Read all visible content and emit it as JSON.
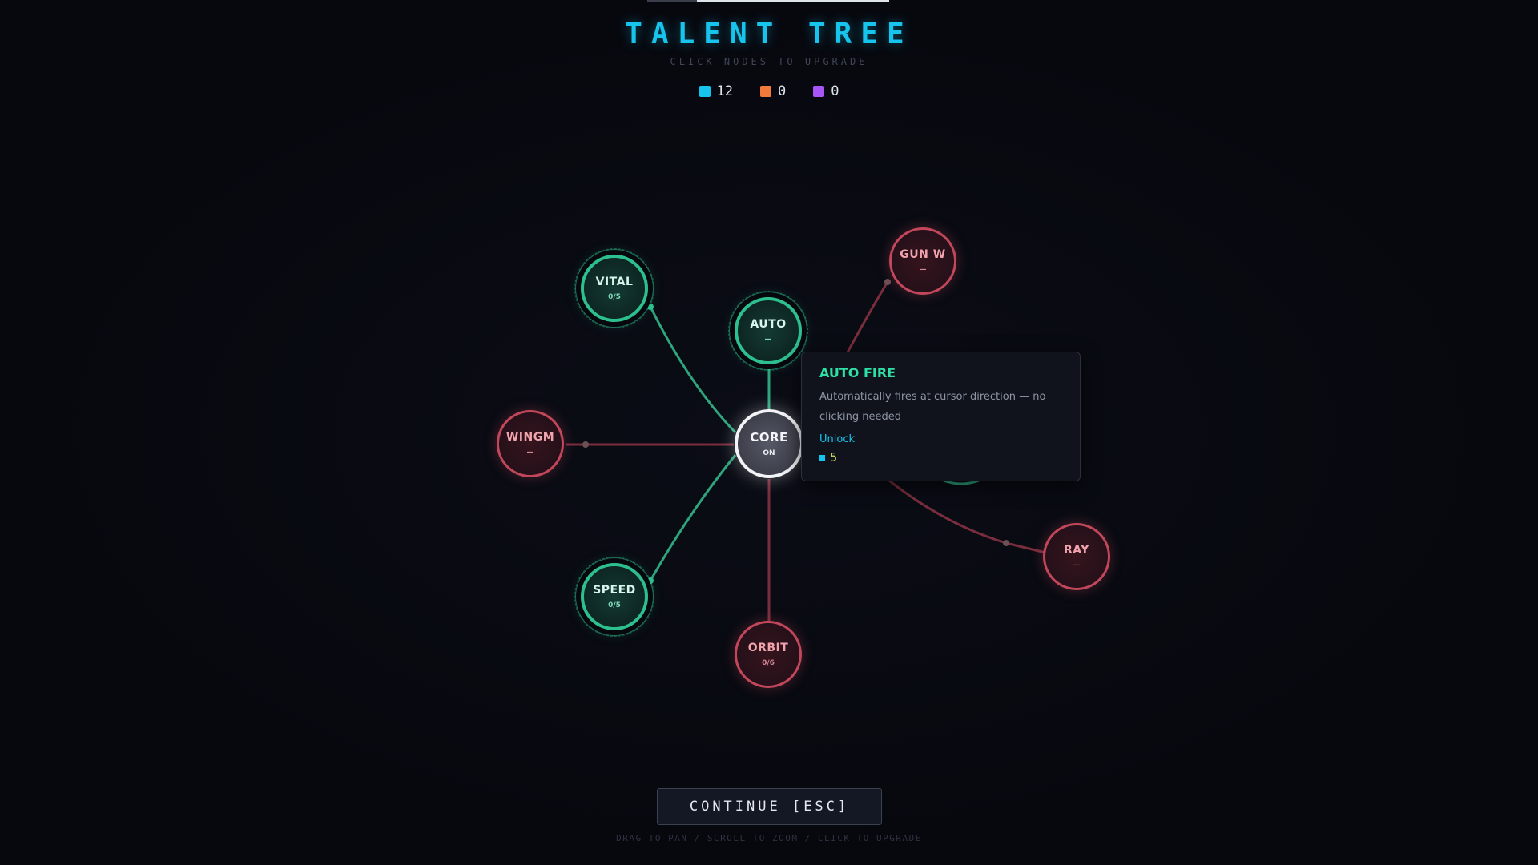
{
  "header": {
    "title": "TALENT TREE",
    "subtitle": "CLICK NODES TO UPGRADE"
  },
  "currencies": [
    {
      "icon": "cyan-currency-icon",
      "color": "#16c4ee",
      "value": "12"
    },
    {
      "icon": "orange-currency-icon",
      "color": "#f27a3a",
      "value": "0"
    },
    {
      "icon": "purple-currency-icon",
      "color": "#a855f7",
      "value": "0"
    }
  ],
  "nodes": {
    "core": {
      "label": "CORE",
      "level": "ON",
      "state": "active"
    },
    "vital": {
      "label": "VITAL",
      "level": "0/5",
      "state": "available"
    },
    "auto": {
      "label": "AUTO",
      "level": "—",
      "state": "available"
    },
    "speed": {
      "label": "SPEED",
      "level": "0/5",
      "state": "available"
    },
    "wingm": {
      "label": "WINGM",
      "level": "—",
      "state": "locked"
    },
    "orbit": {
      "label": "ORBIT",
      "level": "0/6",
      "state": "locked"
    },
    "gunw": {
      "label": "GUN W",
      "level": "—",
      "state": "locked"
    },
    "ray": {
      "label": "RAY",
      "level": "—",
      "state": "locked"
    }
  },
  "tooltip": {
    "title": "AUTO FIRE",
    "description": "Automatically fires at cursor direction — no clicking needed",
    "action": "Unlock",
    "cost": "5",
    "cost_icon": "cyan-currency-icon"
  },
  "footer": {
    "continue_label": "CONTINUE [ESC]",
    "hint": "DRAG TO PAN / SCROLL TO ZOOM / CLICK TO UPGRADE"
  },
  "colors": {
    "accent": "#16c4ee",
    "available": "#2ebf8f",
    "locked": "#c2475a",
    "background": "#07080e"
  }
}
